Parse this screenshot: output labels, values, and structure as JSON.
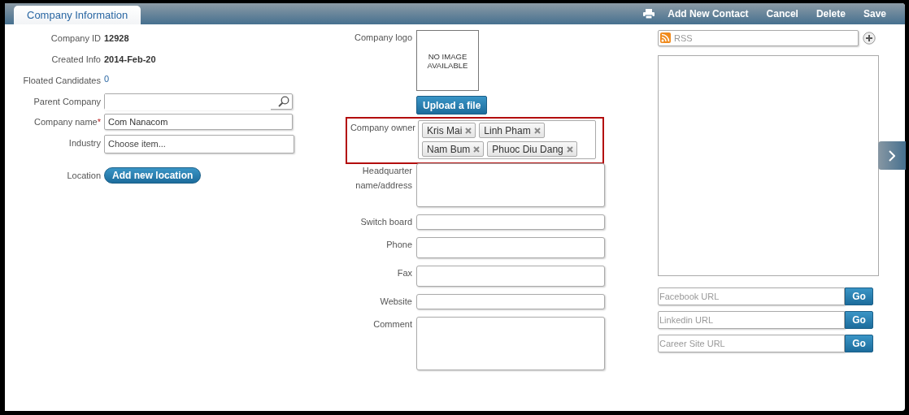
{
  "tabs": [
    {
      "label": "Company Information",
      "selected": true
    }
  ],
  "toolbar": [
    {
      "kind": "print"
    },
    {
      "kind": "text",
      "label": "Add New Contact"
    },
    {
      "kind": "text",
      "label": "Cancel"
    },
    {
      "kind": "text",
      "label": "Delete"
    },
    {
      "kind": "text",
      "label": "Save"
    }
  ],
  "left_fields": [
    {
      "kind": "value",
      "label": "Company ID",
      "value": "12928"
    },
    {
      "kind": "value",
      "label": "Created Info",
      "value": "2014-Feb-20"
    },
    {
      "kind": "link",
      "label": "Floated Candidates",
      "value": "0"
    },
    {
      "kind": "search",
      "label": "Parent Company"
    },
    {
      "kind": "text",
      "label": "Company name",
      "required_mark": "*",
      "value": "Com Nanacom"
    },
    {
      "kind": "select",
      "label": "Industry",
      "placeholder": "Choose item..."
    },
    {
      "kind": "button",
      "label": "Location",
      "button": "Add new location"
    }
  ],
  "logo": {
    "label": "Company logo",
    "placeholder_text": "NO IMAGE AVAILABLE",
    "upload_button": "Upload a file"
  },
  "owner": {
    "label": "Company owner",
    "highlighted": true,
    "tags": [
      "Kris Mai",
      "Linh Pham",
      "Nam Bum",
      "Phuoc Diu Dang"
    ]
  },
  "middle_fields": [
    {
      "kind": "textarea",
      "label": "Headquarter name/address"
    },
    {
      "kind": "input",
      "label": "Switch board"
    },
    {
      "kind": "tall-input",
      "label": "Phone"
    },
    {
      "kind": "tall-input",
      "label": "Fax"
    },
    {
      "kind": "input",
      "label": "Website"
    },
    {
      "kind": "large-textarea",
      "label": "Comment"
    }
  ],
  "rss": {
    "placeholder": "RSS"
  },
  "url_fields": [
    {
      "placeholder": "Facebook URL",
      "button": "Go"
    },
    {
      "placeholder": "Linkedin URL",
      "button": "Go"
    },
    {
      "placeholder": "Career Site URL",
      "button": "Go"
    }
  ]
}
